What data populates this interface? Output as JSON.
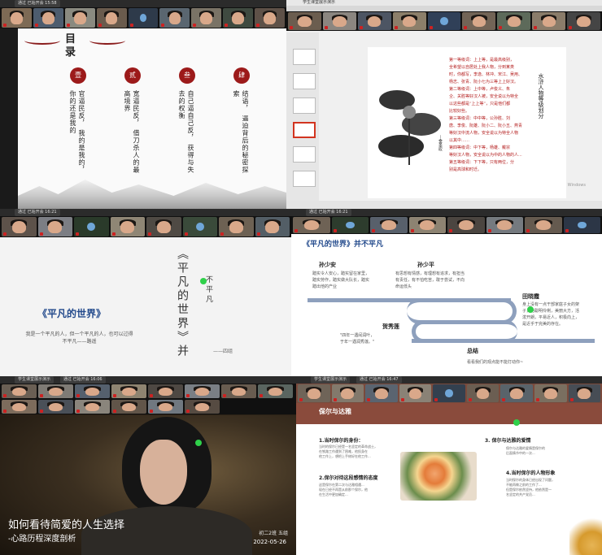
{
  "panels": {
    "p1": {
      "title_bar": "通过 已始开会 15:58",
      "slide": {
        "title_chars": [
          "目",
          "录"
        ],
        "sections": [
          {
            "num": "壹",
            "lines": [
              "官逼民反，",
              "我的是我的，",
              "你的还是我的"
            ]
          },
          {
            "num": "贰",
            "lines": [
              "宽逼民反，",
              "借刀杀人的最高境界"
            ]
          },
          {
            "num": "叁",
            "lines": [
              "自己逼自己反，",
              "获得与失去的权衡"
            ]
          },
          {
            "num": "肆",
            "lines": [
              "结语，",
              "逼迫背后的秘密探索"
            ]
          }
        ]
      }
    },
    "p2": {
      "title_bar": "学生课堂展示演示",
      "meeting_bar": "通过 已始开会 16:23",
      "poem": [
        "第一等级词：上上等，是最高级别，",
        "全希望以自居处上我人物，分到某类",
        "时，你都写，李逸、林冲、宋江、吴用、",
        "杨志、张青、阮小七为三等上上好汉。",
        "第二等级词：上中等，卢俊义、朱",
        "仝、关胜等好汉人被，安全说以为特全",
        "以这些都是“上上等”，只是他们都",
        "比较好些。",
        "第三等级词：中中等，公孙胜、刘",
        "唐、李俊、阮雄、阮小二、阮小五、燕青",
        "等好汉中流人物，安全说以为特全人物",
        "以其中……",
        "第四等级词：中下等，杨雄、戴宗",
        "等好汉人物，安全说以为中的人物的人...",
        "第五等级词：下下等，只有两位，分",
        "别是高球和时迁。"
      ],
      "vertical_title": "水浒人物等级划分",
      "vertical_author": "—金圣叹",
      "watermark": "Windows"
    },
    "p3": {
      "title_bar": "通过 已始开会 16:21",
      "big_vertical": "《平凡的世界》并",
      "small_vertical": "不平凡",
      "book_title": "《平凡的世界》",
      "quote": "我是一个平凡的人，但一个平凡的人，也可以过得不平凡——路遥",
      "signature": "——四组"
    },
    "p4": {
      "title_bar": "通过 已始开会 16:21",
      "heading": "《平凡的世界》并不平凡",
      "people": [
        {
          "name": "孙少安",
          "desc": [
            "踏实令人安心，踏实留在家里，",
            "踏实劳作，踏实做大队长，踏实",
            "踏出他的产业"
          ]
        },
        {
          "name": "孙少平",
          "desc": [
            "有思想有情感，有理想有追求，有担当",
            "有责任，有不怕吃苦，敢于尝试，不向",
            "命运低头"
          ]
        },
        {
          "name": "田晓霞",
          "desc": [
            "身上没有一点干部家庭子女的架",
            "子，她聪明伶俐，美丽大方，活",
            "泼开朗，平易近人，积极向上，",
            "是近乎于完美的存在。"
          ]
        },
        {
          "name": "贺秀莲",
          "desc": [
            "\"四年一遇闰润叶，",
            "于年一遇润秀莲。\""
          ]
        },
        {
          "name": "总结",
          "desc": [
            "看看我们的观点能不能打动你~"
          ]
        }
      ]
    },
    "p5": {
      "title_bar": "学生课堂展示演示",
      "meeting_bar": "通过 已始开会 16:06",
      "title": "如何看待简爱的人生选择",
      "subtitle": "-心路历程深度剖析",
      "class_info": "初二2班  五组",
      "date": "2022-05-26"
    },
    "p6": {
      "title_bar": "学生课堂展示演示",
      "meeting_bar": "通过 已始开会 16:47",
      "heading": "保尔与达雅",
      "sections": [
        {
          "title": "1.当时保尔的身份：",
          "text": [
            "当时的保尔已经是一名坚定的革命战士，",
            "在铁路工作遇到了困难，他投身在",
            "他工作上，想把上手修好在他工作..."
          ]
        },
        {
          "title": "2.保尔对待这段感情的态度",
          "text": [
            "这是保尔在第二次与达雅相遇...",
            "现在已经不再是从前那个保尔，他",
            "在生活中更加确定..."
          ]
        },
        {
          "title": "3. 保尔与达雅的爱情",
          "text": [
            "保尔与达雅的爱情是保尔的",
            "后面情节中的一次..."
          ]
        },
        {
          "title": "4.当时保尔的人物形象",
          "text": [
            "当时保尔的身体已经出现了问题，",
            "不能再做之前的工作了...",
            "但是保尔依然坚持，他依然是一",
            "名坚定的共产党员..."
          ]
        }
      ]
    }
  }
}
